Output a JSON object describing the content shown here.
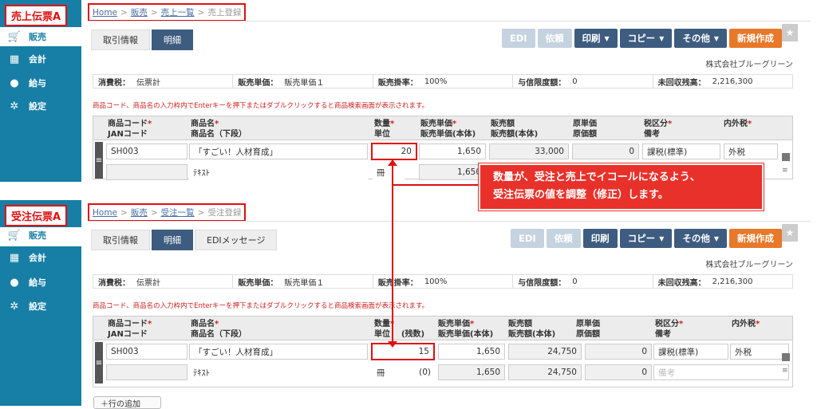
{
  "labelA": "売上伝票A",
  "labelB": "受注伝票A",
  "sidebar": {
    "items": [
      {
        "label": "販売"
      },
      {
        "label": "会計"
      },
      {
        "label": "給与"
      },
      {
        "label": "設定"
      }
    ]
  },
  "panelA": {
    "breadcrumb": {
      "home": "Home",
      "sales": "販売",
      "list": "売上一覧",
      "current": "売上登録"
    },
    "tabs": [
      "取引情報",
      "明細"
    ],
    "quantity": "20",
    "buttons": {
      "edi": "EDI",
      "request": "依頼",
      "print": "印刷",
      "copy": "コピー",
      "other": "その他",
      "new": "新規作成"
    }
  },
  "panelB": {
    "breadcrumb": {
      "home": "Home",
      "sales": "販売",
      "list": "受注一覧",
      "current": "受注登録"
    },
    "tabs": [
      "取引情報",
      "明細",
      "EDIメッセージ"
    ],
    "quantity": "15",
    "amount": "24,750",
    "remaining": "(0)",
    "memo_placeholder": "備考",
    "buttons": {
      "edi": "EDI",
      "request": "依頼",
      "print": "印刷",
      "copy": "コピー",
      "other": "その他",
      "new": "新規作成"
    }
  },
  "company": "株式会社ブルーグリーン",
  "info": {
    "tax_label": "消費税：",
    "tax_value": "伝票計",
    "price_label": "販売単価：",
    "price_value": "販売単価１",
    "rate_label": "販売掛率：",
    "rate_value": "100%",
    "credit_label": "与信限度額：",
    "credit_value": "0",
    "unpaid_label": "未回収残高：",
    "unpaid_value": "2,216,300"
  },
  "notice": "商品コード、商品名の入力枠内でEnterキーを押下またはダブルクリックすると商品検索画面が表示されます。",
  "headers": {
    "code": "商品コード",
    "jan": "JANコード",
    "name": "商品名",
    "name2": "商品名（下段）",
    "qty": "数量",
    "unit": "単位",
    "remain": "(残数)",
    "price": "販売単価",
    "price2": "販売単価(本体)",
    "amount": "販売額",
    "amount2": "販売額(本体)",
    "cost": "原単価",
    "cost2": "原価額",
    "taxcat": "税区分",
    "memo": "備考",
    "taxin": "内外税",
    "req": "*"
  },
  "row": {
    "code": "SH003",
    "name": "「すごい！人材育成」",
    "name2": "ﾃｷｽﾄ",
    "unit": "冊",
    "price": "1,650",
    "amountA": "33,000",
    "cost": "0",
    "taxcat": "課税(標準)",
    "taxin": "外税",
    "price2_partial": "1,650"
  },
  "callout": {
    "line1": "数量が、受注と売上でイコールになるよう、",
    "line2": "受注伝票の値を調整（修正）します。"
  },
  "add_row": "＋行の追加"
}
